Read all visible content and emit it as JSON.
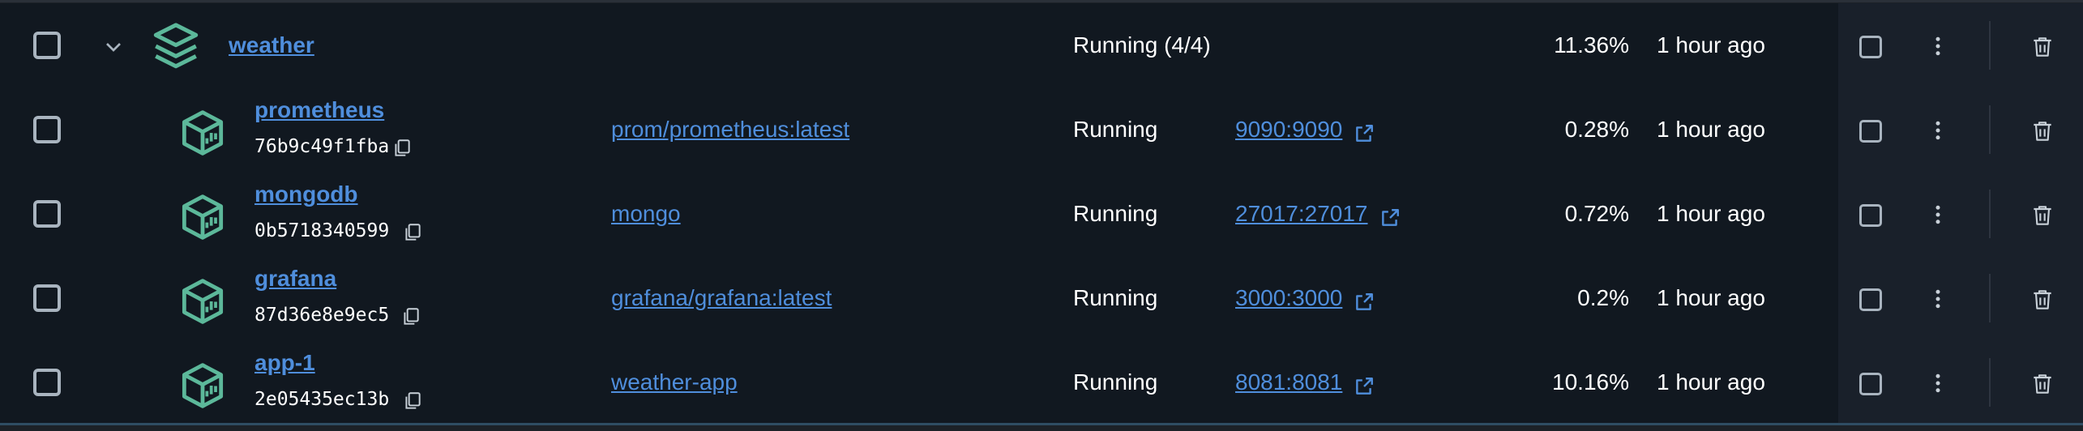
{
  "colors": {
    "accent": "#4f8edc",
    "icon_green": "#5cb89a",
    "row_bg": "#111820"
  },
  "group": {
    "name": "weather",
    "status": "Running (4/4)",
    "cpu": "11.36%",
    "last_started": "1 hour ago",
    "icon": "stack-icon"
  },
  "containers": [
    {
      "name": "prometheus",
      "id": "76b9c49f1fba",
      "image": "prom/prometheus:latest",
      "status": "Running",
      "port": "9090:9090",
      "cpu": "0.28%",
      "last_started": "1 hour ago"
    },
    {
      "name": "mongodb",
      "id": "0b5718340599",
      "image": "mongo",
      "status": "Running",
      "port": "27017:27017",
      "cpu": "0.72%",
      "last_started": "1 hour ago"
    },
    {
      "name": "grafana",
      "id": "87d36e8e9ec5",
      "image": "grafana/grafana:latest",
      "status": "Running",
      "port": "3000:3000",
      "cpu": "0.2%",
      "last_started": "1 hour ago"
    },
    {
      "name": "app-1",
      "id": "2e05435ec13b",
      "image": "weather-app",
      "status": "Running",
      "port": "8081:8081",
      "cpu": "10.16%",
      "last_started": "1 hour ago"
    }
  ]
}
